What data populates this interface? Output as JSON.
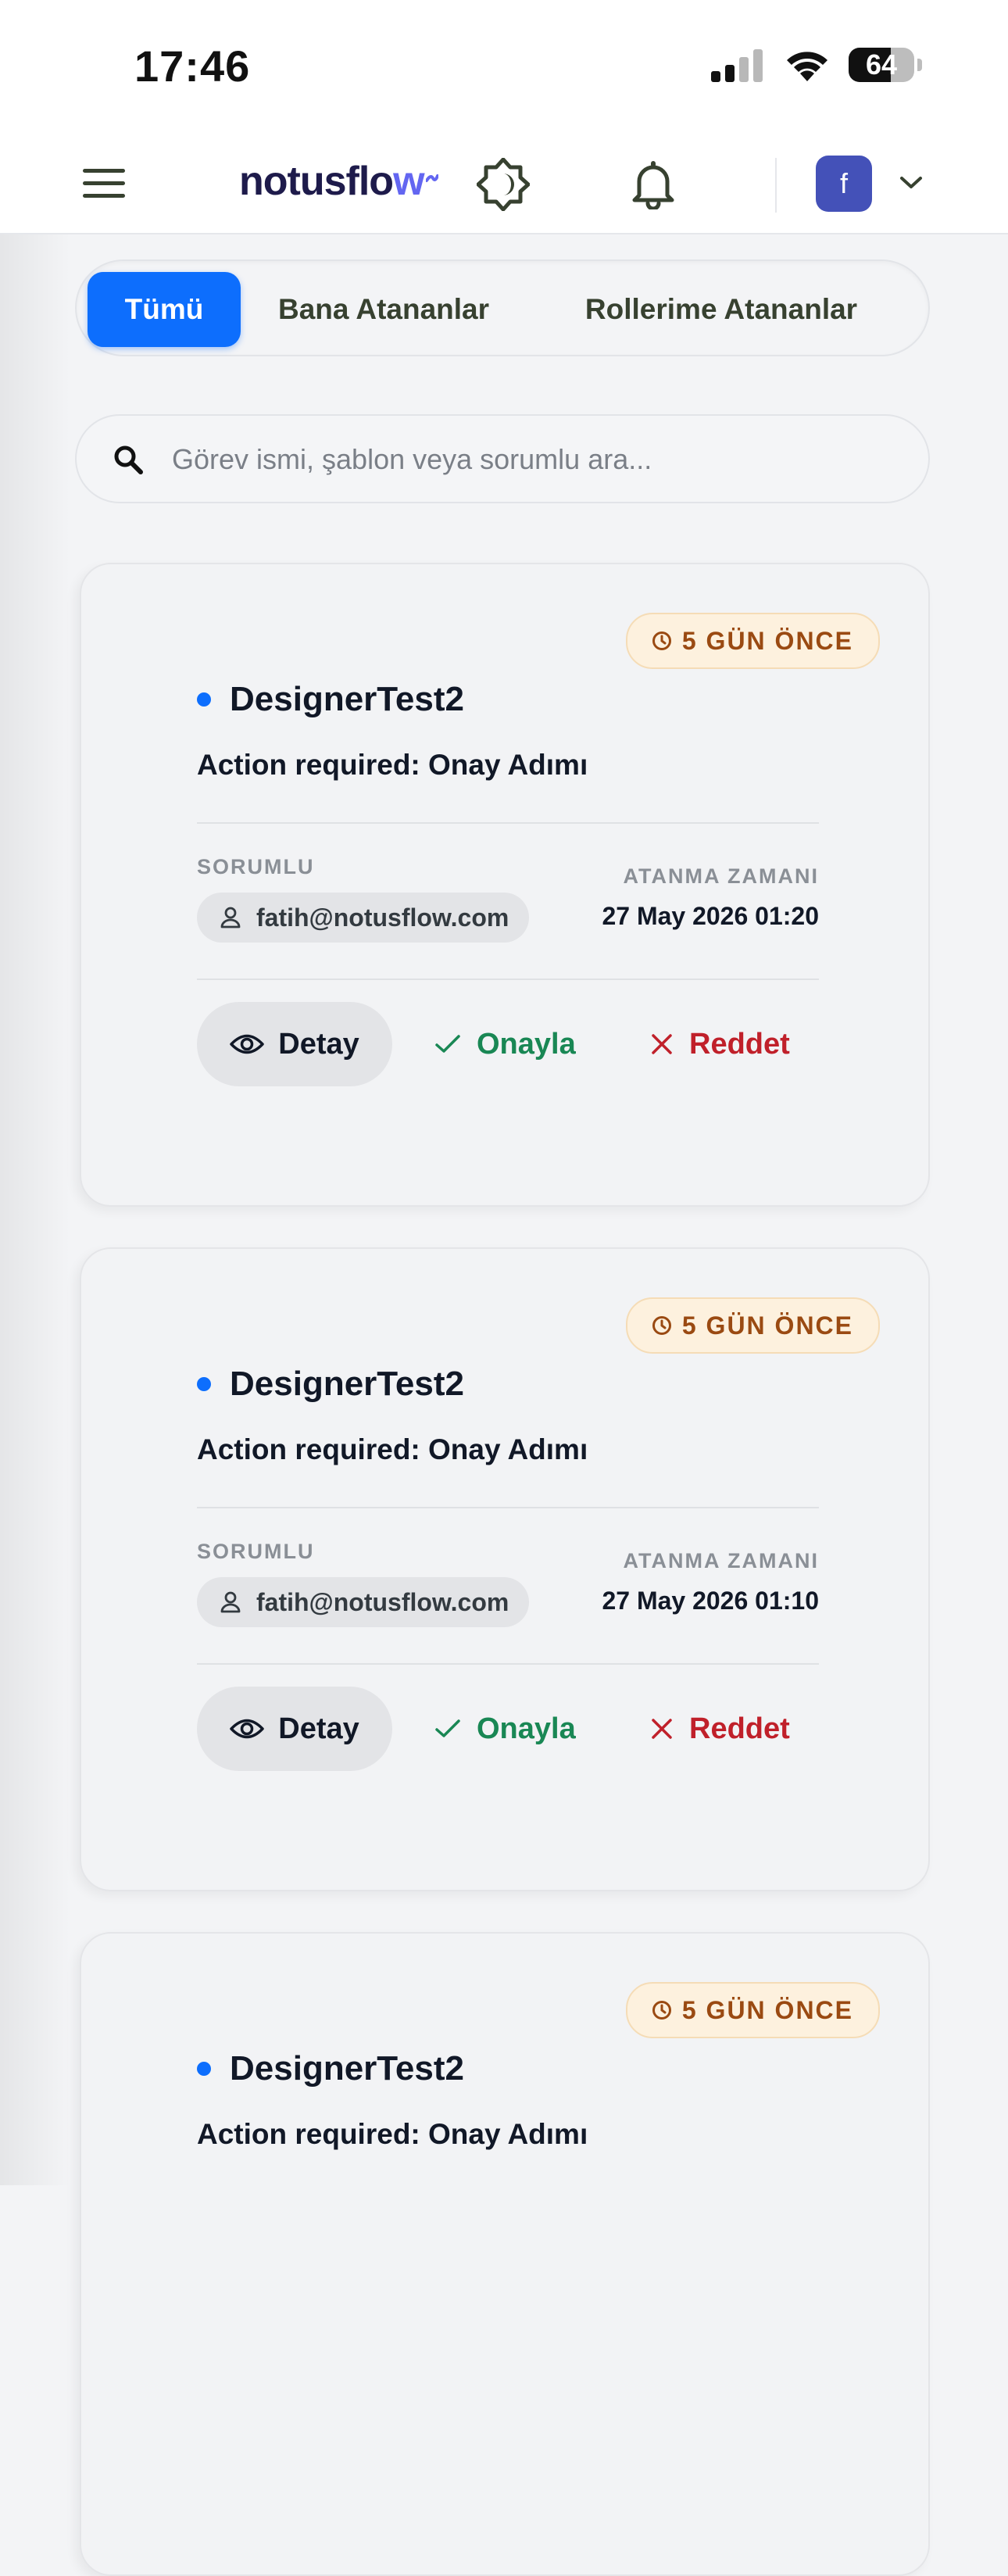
{
  "status_bar": {
    "time": "17:46",
    "battery_level": "64",
    "battery_fraction": 0.64
  },
  "header": {
    "logo_main": "notusflo",
    "logo_accent": "w",
    "avatar_letter": "f"
  },
  "tabs": [
    {
      "label": "Tümü",
      "active": true
    },
    {
      "label": "Bana Atananlar",
      "active": false
    },
    {
      "label": "Rollerime Atananlar",
      "active": false
    }
  ],
  "search": {
    "placeholder": "Görev ismi, şablon veya sorumlu ara...",
    "value": ""
  },
  "colors": {
    "accent": "#0d6efd",
    "approve": "#198754",
    "reject": "#c0202a",
    "badge_text": "#9a4a12",
    "avatar": "#4451b8"
  },
  "tasks": [
    {
      "age_badge": "5 GÜN ÖNCE",
      "title": "DesignerTest2",
      "subtitle": "Action required: Onay Adımı",
      "assignee_label": "SORUMLU",
      "assignee": "fatih@notusflow.com",
      "assigned_label": "ATANMA ZAMANI",
      "assigned_time": "27 May 2026 01:20",
      "detail_label": "Detay",
      "approve_label": "Onayla",
      "reject_label": "Reddet"
    },
    {
      "age_badge": "5 GÜN ÖNCE",
      "title": "DesignerTest2",
      "subtitle": "Action required: Onay Adımı",
      "assignee_label": "SORUMLU",
      "assignee": "fatih@notusflow.com",
      "assigned_label": "ATANMA ZAMANI",
      "assigned_time": "27 May 2026 01:10",
      "detail_label": "Detay",
      "approve_label": "Onayla",
      "reject_label": "Reddet"
    },
    {
      "age_badge": "5 GÜN ÖNCE",
      "title": "DesignerTest2",
      "subtitle": "Action required: Onay Adımı"
    }
  ]
}
